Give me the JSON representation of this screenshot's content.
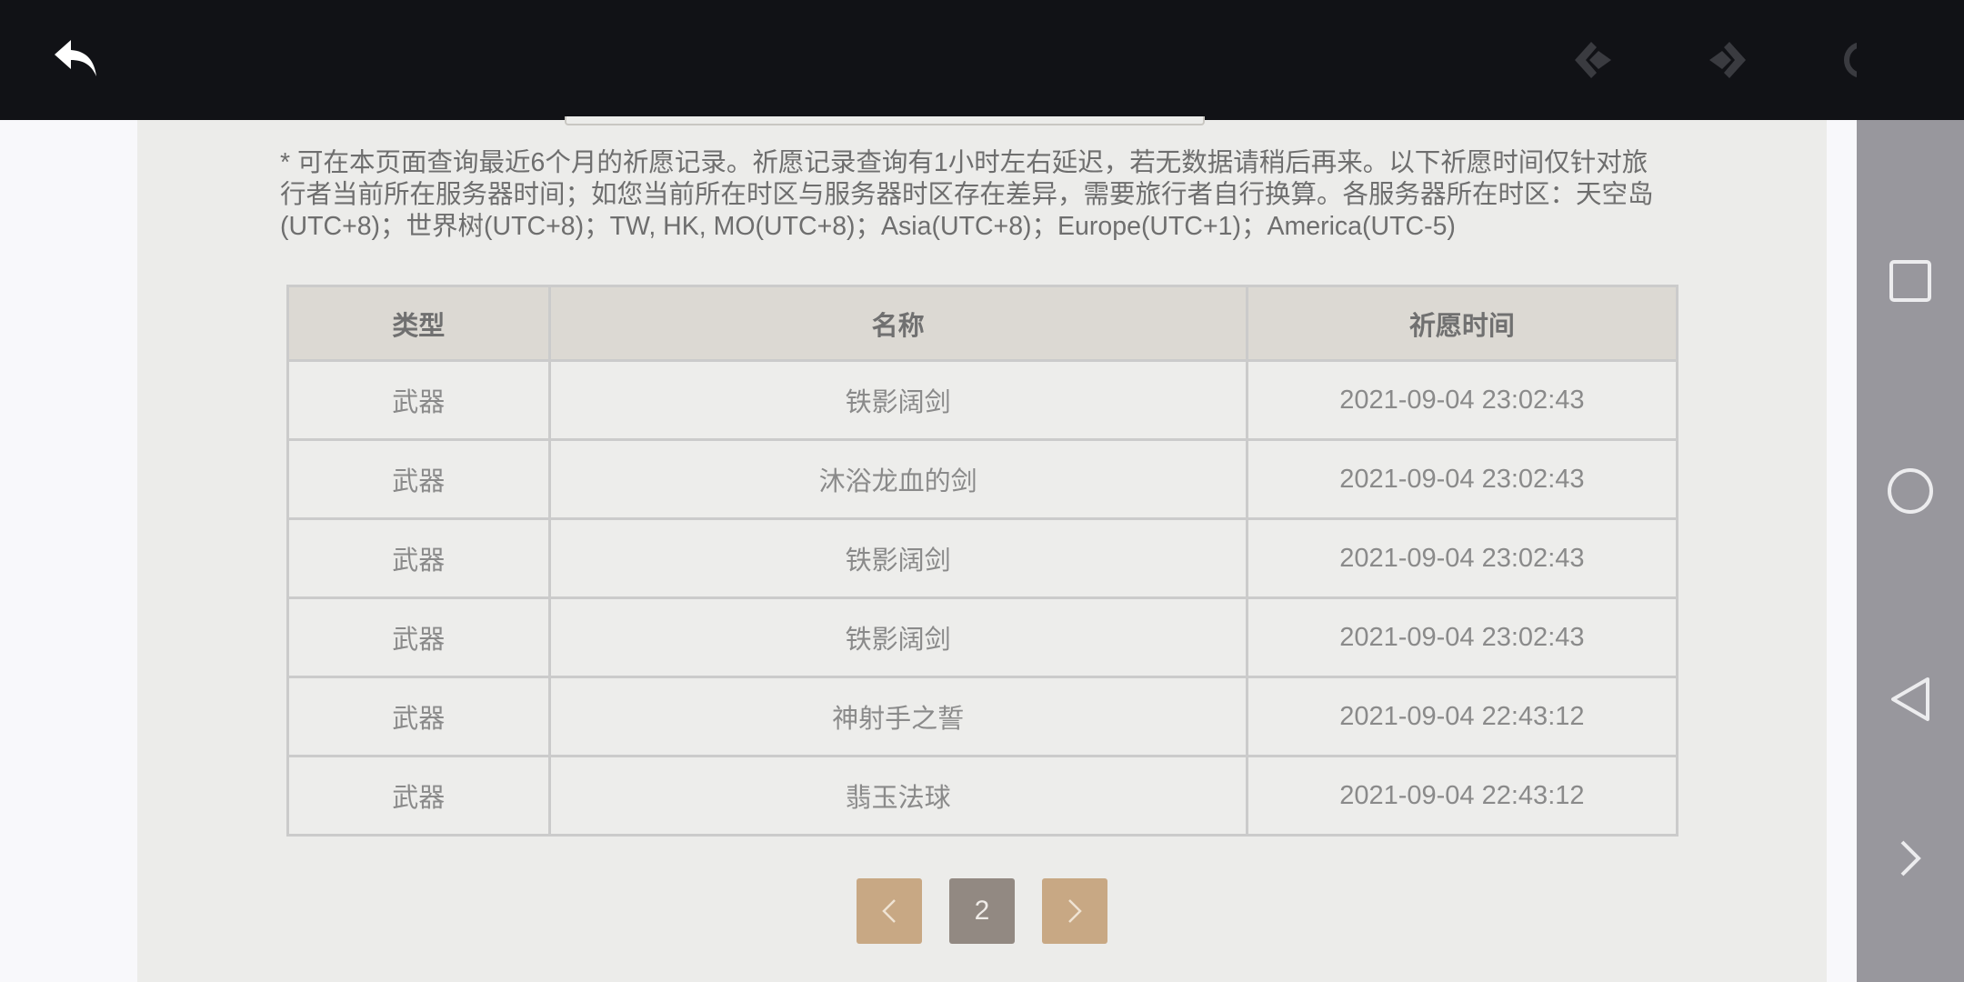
{
  "toolbar": {
    "back_icon": "back-arrow-icon",
    "prev_icon": "prev-diamond-icon",
    "next_icon": "next-diamond-icon",
    "reload_icon": "reload-icon"
  },
  "notice": "* 可在本页面查询最近6个月的祈愿记录。祈愿记录查询有1小时左右延迟，若无数据请稍后再来。以下祈愿时间仅针对旅行者当前所在服务器时间；如您当前所在时区与服务器时区存在差异，需要旅行者自行换算。各服务器所在时区：天空岛(UTC+8)；世界树(UTC+8)；TW, HK, MO(UTC+8)；Asia(UTC+8)；Europe(UTC+1)；America(UTC-5)",
  "table": {
    "headers": [
      "类型",
      "名称",
      "祈愿时间"
    ],
    "rows": [
      {
        "type": "武器",
        "name": "铁影阔剑",
        "time": "2021-09-04 23:02:43"
      },
      {
        "type": "武器",
        "name": "沐浴龙血的剑",
        "time": "2021-09-04 23:02:43"
      },
      {
        "type": "武器",
        "name": "铁影阔剑",
        "time": "2021-09-04 23:02:43"
      },
      {
        "type": "武器",
        "name": "铁影阔剑",
        "time": "2021-09-04 23:02:43"
      },
      {
        "type": "武器",
        "name": "神射手之誓",
        "time": "2021-09-04 22:43:12"
      },
      {
        "type": "武器",
        "name": "翡玉法球",
        "time": "2021-09-04 22:43:12"
      }
    ]
  },
  "pager": {
    "current_page": "2"
  },
  "colors": {
    "topbar": "#111216",
    "accent_button": "#c8a884",
    "current_page": "#928982",
    "header_bg": "#dcd9d3"
  }
}
